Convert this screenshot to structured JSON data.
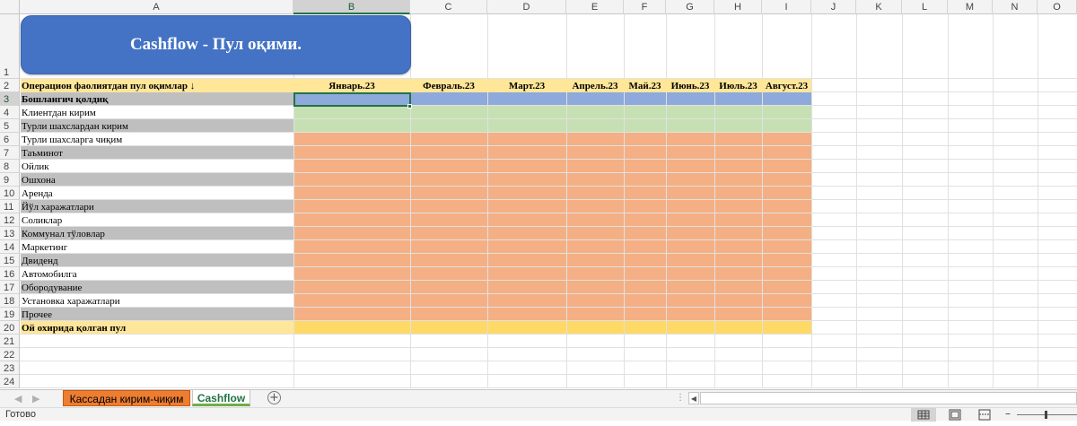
{
  "columns": [
    "A",
    "B",
    "C",
    "D",
    "E",
    "F",
    "G",
    "H",
    "I",
    "J",
    "K",
    "L",
    "M",
    "N",
    "O"
  ],
  "rows": [
    "1",
    "2",
    "3",
    "4",
    "5",
    "6",
    "7",
    "8",
    "9",
    "10",
    "11",
    "12",
    "13",
    "14",
    "15",
    "16",
    "17",
    "18",
    "19",
    "20",
    "21",
    "22",
    "23",
    "24"
  ],
  "title": "Cashflow - Пул оқими.",
  "table": {
    "header_label": "Операцион фаолиятдан пул оқимлар ↓",
    "months": [
      "Январь.23",
      "Февраль.23",
      "Март.23",
      "Апрель.23",
      "Май.23",
      "Июнь.23",
      "Июль.23",
      "Август.23"
    ],
    "items": [
      "Бошлангич қолдиқ",
      "Клиентдан кирим",
      "Турли шахслардан кирим",
      "Турли шахсларга чиқим",
      "Таъминот",
      "Ойлик",
      "Ошхона",
      "Аренда",
      "Йўл харажатлари",
      "Соликлар",
      "Коммунал тўловлар",
      "Маркетинг",
      "Двиденд",
      "Автомобилга",
      "Обородувание",
      "Установка харажатлари",
      "Прочее",
      "Ой охирида қолган пул"
    ]
  },
  "colors": {
    "title_bg": "#4472c4",
    "header_row": "#ffe699",
    "opening_row": "#8ea9db",
    "income_rows": "#c6e0b4",
    "expense_rows": "#f4b084",
    "closing_row": "#ffd966",
    "label_gray": "#bfbfbf",
    "accent": "#217346"
  },
  "sheets": [
    {
      "label": "Кассадан кирим-чиқим",
      "color": "#ed7d31",
      "active": false
    },
    {
      "label": "Cashflow",
      "color": "#70ad47",
      "active": true
    }
  ],
  "status": {
    "ready": "Готово"
  },
  "icons": {
    "add_sheet": "plus-circle-icon",
    "scroll_left": "chevron-left-icon",
    "scroll_right": "chevron-right-icon",
    "normal_view": "grid-view-icon",
    "page_layout": "page-layout-icon",
    "page_break": "page-break-icon"
  }
}
